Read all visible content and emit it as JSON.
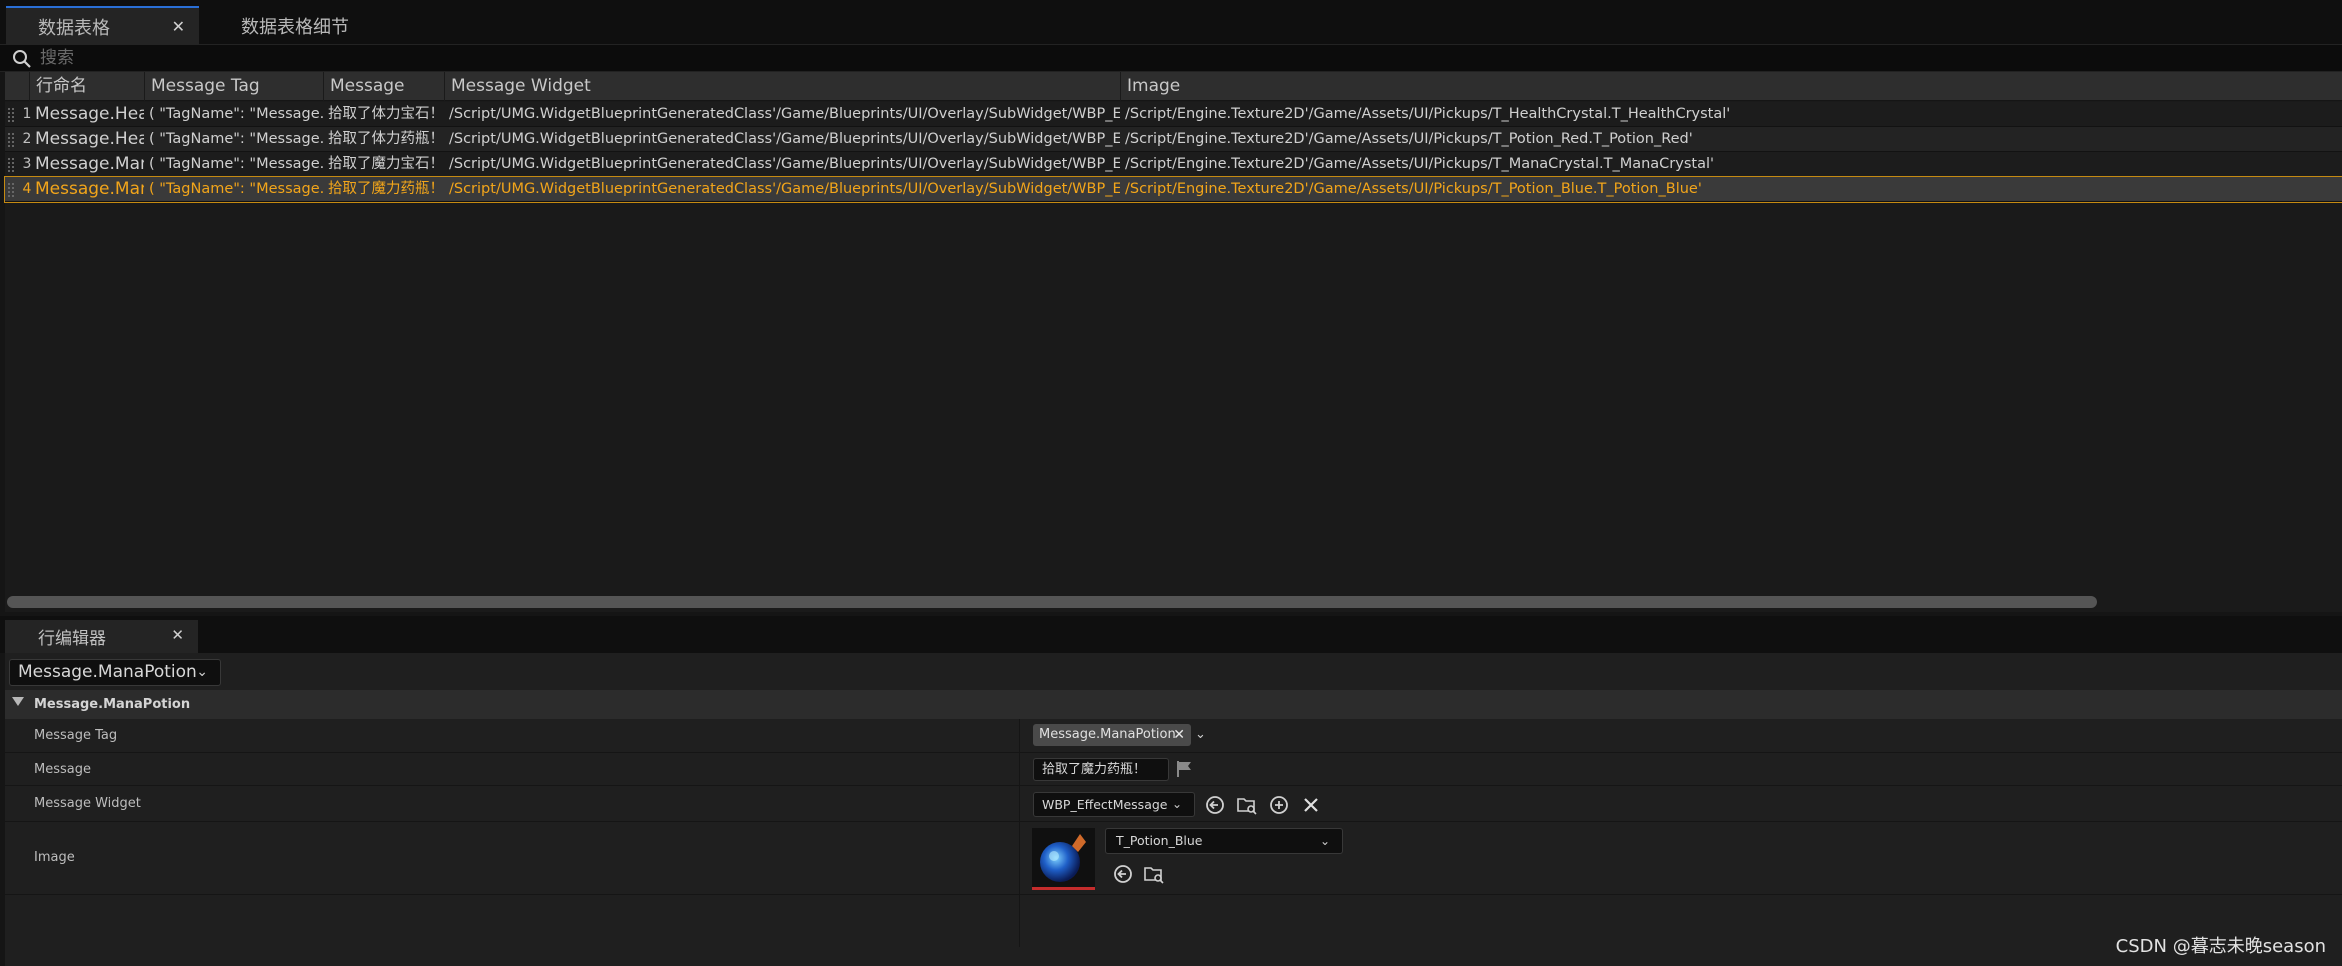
{
  "tabs": [
    {
      "label": "数据表格",
      "active": true
    },
    {
      "label": "数据表格细节",
      "active": false
    }
  ],
  "search": {
    "placeholder": "搜索"
  },
  "table": {
    "columns": [
      "行命名",
      "Message Tag",
      "Message",
      "Message Widget",
      "Image"
    ],
    "rows": [
      {
        "index": "1",
        "name": "Message.HealthCrys",
        "tag": "( \"TagName\": \"Message.HealthCrystal",
        "message": "拾取了体力宝石！",
        "widget": "/Script/UMG.WidgetBlueprintGeneratedClass'/Game/Blueprints/UI/Overlay/SubWidget/WBP_EffectMessage.WBP_EffectMessage_C'",
        "image": "/Script/Engine.Texture2D'/Game/Assets/UI/Pickups/T_HealthCrystal.T_HealthCrystal'"
      },
      {
        "index": "2",
        "name": "Message.HealthPoti",
        "tag": "( \"TagName\": \"Message.HealthPotion\"",
        "message": "拾取了体力药瓶！",
        "widget": "/Script/UMG.WidgetBlueprintGeneratedClass'/Game/Blueprints/UI/Overlay/SubWidget/WBP_EffectMessage.WBP_EffectMessage_C'",
        "image": "/Script/Engine.Texture2D'/Game/Assets/UI/Pickups/T_Potion_Red.T_Potion_Red'"
      },
      {
        "index": "3",
        "name": "Message.ManaCryst",
        "tag": "( \"TagName\": \"Message.ManaCrystal\"",
        "message": "拾取了魔力宝石！",
        "widget": "/Script/UMG.WidgetBlueprintGeneratedClass'/Game/Blueprints/UI/Overlay/SubWidget/WBP_EffectMessage.WBP_EffectMessage_C'",
        "image": "/Script/Engine.Texture2D'/Game/Assets/UI/Pickups/T_ManaCrystal.T_ManaCrystal'"
      },
      {
        "index": "4",
        "name": "Message.ManaPotio",
        "tag": "( \"TagName\": \"Message.ManaPotion\"",
        "message": "拾取了魔力药瓶！",
        "widget": "/Script/UMG.WidgetBlueprintGeneratedClass'/Game/Blueprints/UI/Overlay/SubWidget/WBP_EffectMessage.WBP_EffectMessage_C'",
        "image": "/Script/Engine.Texture2D'/Game/Assets/UI/Pickups/T_Potion_Blue.T_Potion_Blue'"
      }
    ],
    "selected_index": 4
  },
  "editor": {
    "tab_label": "行编辑器",
    "row_selector": "Message.ManaPotion",
    "category": "Message.ManaPotion",
    "fields": {
      "message_tag_label": "Message Tag",
      "message_tag_value": "Message.ManaPotion",
      "message_label": "Message",
      "message_value": "拾取了魔力药瓶！",
      "message_widget_label": "Message Widget",
      "message_widget_value": "WBP_EffectMessage",
      "image_label": "Image",
      "image_value": "T_Potion_Blue"
    }
  },
  "icons": {
    "search": "search-icon",
    "close": "close-icon",
    "chevron": "chevron-down-icon",
    "flag": "flag-icon",
    "use_selected": "use-selected-icon",
    "browse": "browse-asset-icon",
    "add": "add-icon",
    "clear": "clear-icon"
  },
  "colors": {
    "selected_text": "#f2a51a",
    "active_tab_accent": "#2a6fd6",
    "thumbnail_underline": "#c42c2c"
  },
  "watermark": "CSDN @暮志未晚season"
}
